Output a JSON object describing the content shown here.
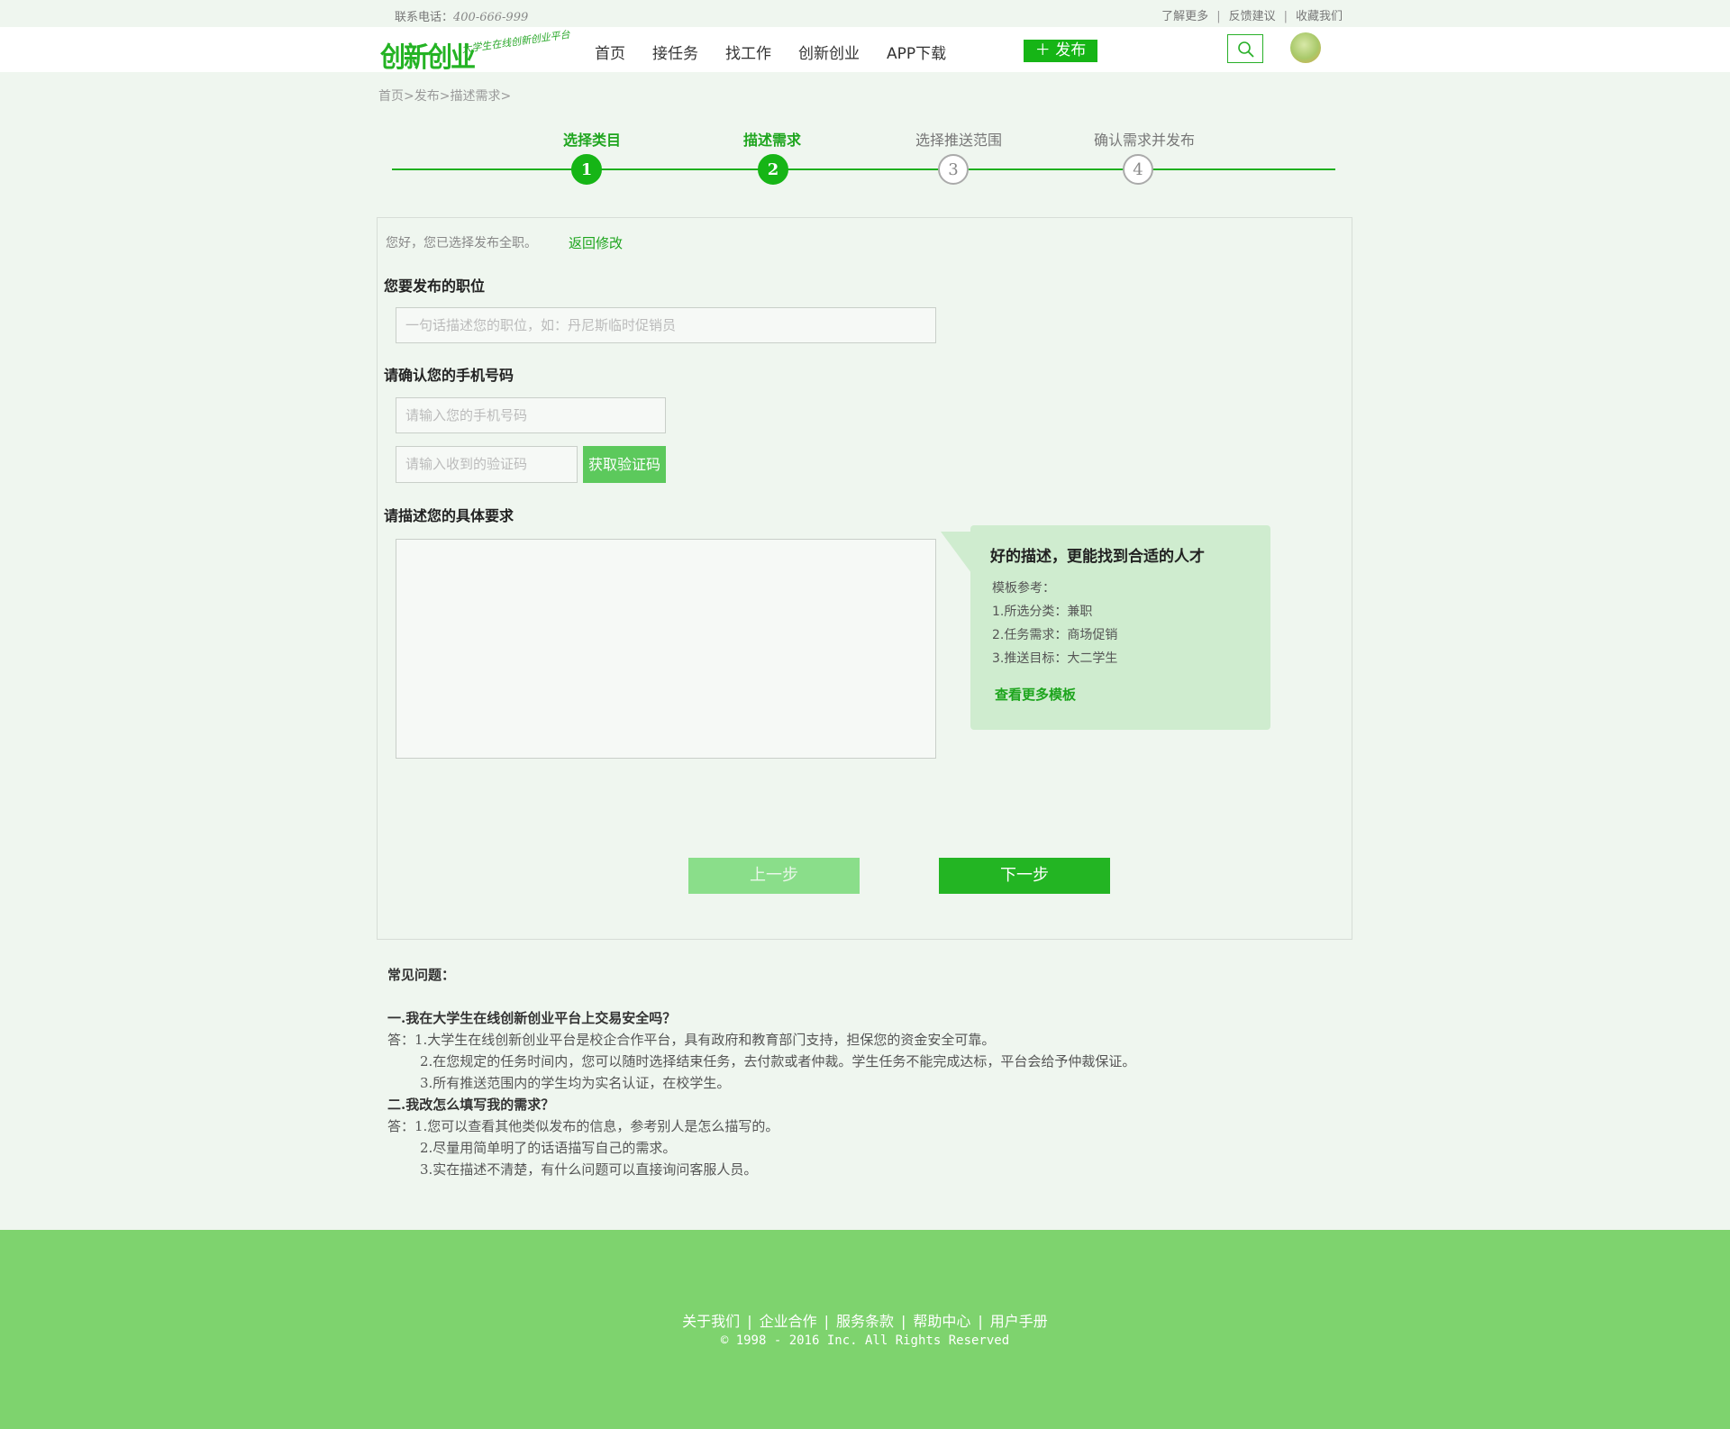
{
  "topbar": {
    "phone_label": "联系电话：",
    "phone_number": "400-666-999",
    "links": [
      "了解更多",
      "反馈建议",
      "收藏我们"
    ]
  },
  "header": {
    "logo_text": "创新创业",
    "logo_slogan": "大学生在线创新创业平台",
    "nav": [
      "首页",
      "接任务",
      "找工作",
      "创新创业",
      "APP下载"
    ],
    "publish_label": "＋ 发布"
  },
  "breadcrumb": "首页>发布>描述需求>",
  "steps": [
    {
      "label": "选择类目",
      "num": "1",
      "state": "active"
    },
    {
      "label": "描述需求",
      "num": "2",
      "state": "active"
    },
    {
      "label": "选择推送范围",
      "num": "3",
      "state": "inactive"
    },
    {
      "label": "确认需求并发布",
      "num": "4",
      "state": "inactive"
    }
  ],
  "form": {
    "notice": "您好，您已选择发布全职。",
    "back_link": "返回修改",
    "position_title": "您要发布的职位",
    "position_placeholder": "一句话描述您的职位，如：丹尼斯临时促销员",
    "phone_title": "请确认您的手机号码",
    "phone_placeholder": "请输入您的手机号码",
    "code_placeholder": "请输入收到的验证码",
    "get_code_label": "获取验证码",
    "desc_title": "请描述您的具体要求",
    "prev_label": "上一步",
    "next_label": "下一步"
  },
  "tip": {
    "title": "好的描述，更能找到合适的人才",
    "subtitle": "模板参考：",
    "lines": [
      "1.所选分类：兼职",
      "2.任务需求：商场促销",
      "3.推送目标：大二学生"
    ],
    "more": "查看更多模板"
  },
  "faq": {
    "title": "常见问题：",
    "q1": "一.我在大学生在线创新创业平台上交易安全吗？",
    "a1_1": "答：1.大学生在线创新创业平台是校企合作平台，具有政府和教育部门支持，担保您的资金安全可靠。",
    "a1_2": "2.在您规定的任务时间内，您可以随时选择结束任务，去付款或者仲裁。学生任务不能完成达标，平台会给予仲裁保证。",
    "a1_3": "3.所有推送范围内的学生均为实名认证，在校学生。",
    "q2": "二.我改怎么填写我的需求？",
    "a2_1": "答：1.您可以查看其他类似发布的信息，参考别人是怎么描写的。",
    "a2_2": "2.尽量用简单明了的话语描写自己的需求。",
    "a2_3": "3.实在描述不清楚，有什么问题可以直接询问客服人员。"
  },
  "footer": {
    "links": [
      "关于我们",
      "企业合作",
      "服务条款",
      "帮助中心",
      "用户手册"
    ],
    "copyright": "© 1998 - 2016  Inc. All Rights Reserved"
  },
  "colors": {
    "brand_green": "#16b516",
    "footer_green": "#7ed36e",
    "tip_bg": "#cfeccf"
  }
}
